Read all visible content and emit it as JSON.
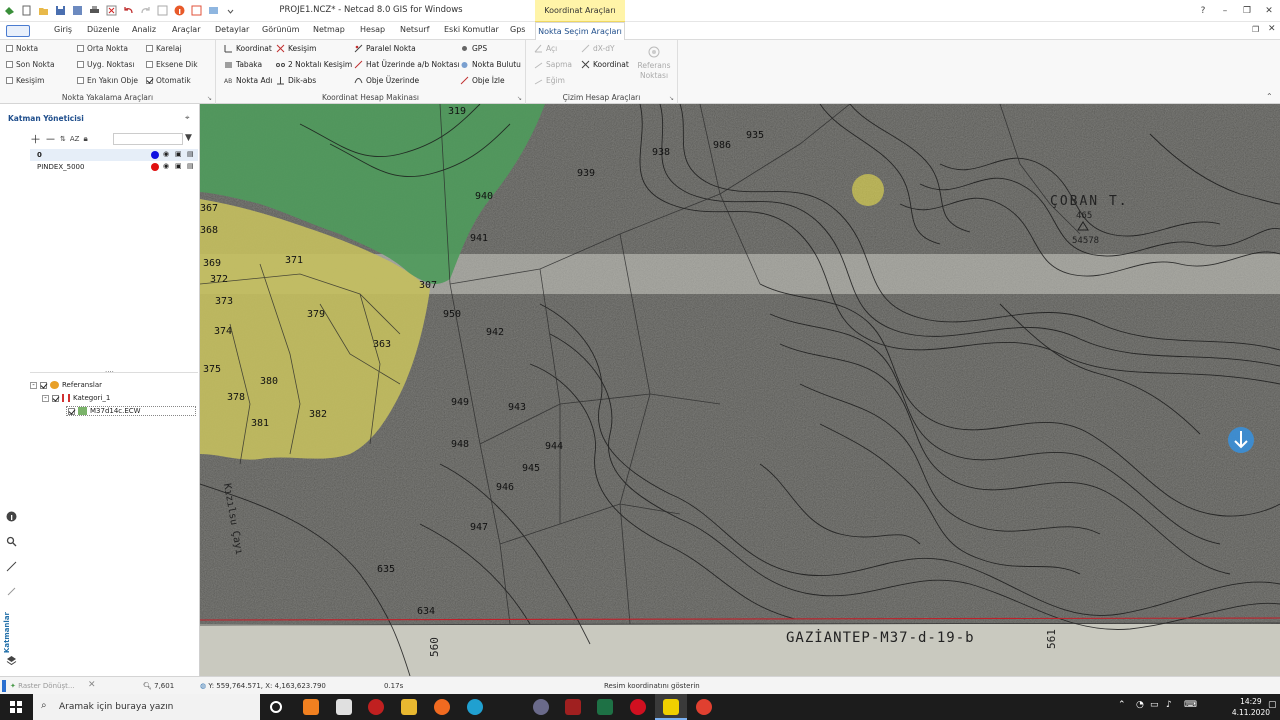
{
  "window": {
    "title": "PROJE1.NCZ* - Netcad 8.0 GIS for Windows",
    "context_tab": "Koordinat Araçları",
    "controls": [
      "?",
      "–",
      "❐",
      "✕"
    ]
  },
  "tabs": [
    "Giriş",
    "Düzenle",
    "Analiz",
    "Araçlar",
    "Detaylar",
    "Görünüm",
    "Netmap",
    "Hesap",
    "Netsurf",
    "Eski Komutlar",
    "Gps"
  ],
  "active_tab": "Nokta Seçim Araçları",
  "ribbon": {
    "snap_group": {
      "caption": "Nokta Yakalama Araçları",
      "items": [
        {
          "label": "Nokta",
          "checked": false
        },
        {
          "label": "Orta Nokta",
          "checked": false
        },
        {
          "label": "Karelaj",
          "checked": false
        },
        {
          "label": "Son Nokta",
          "checked": false
        },
        {
          "label": "Uyg. Noktası",
          "checked": false
        },
        {
          "label": "Eksene Dik",
          "checked": false
        },
        {
          "label": "Kesişim",
          "checked": false
        },
        {
          "label": "En Yakın Obje",
          "checked": false
        },
        {
          "label": "Otomatik",
          "checked": true
        }
      ]
    },
    "calc_group": {
      "caption": "Koordinat Hesap Makinası",
      "items": [
        "Koordinat",
        "Kesişim",
        "Paralel Nokta",
        "GPS",
        "Tabaka",
        "2 Noktalı Kesişim",
        "Hat Üzerinde a/b Noktası",
        "Nokta Bulutu",
        "Nokta Adı",
        "Dik-abs",
        "Obje Üzerinde",
        "Obje İzle"
      ]
    },
    "draw_group": {
      "caption": "Çizim Hesap Araçları",
      "items": [
        "Açı",
        "dX-dY",
        "Sapma",
        "Koordinat",
        "Eğim"
      ]
    },
    "ref_point": {
      "line1": "Referans",
      "line2": "Noktası"
    }
  },
  "layer_manager": {
    "title": "Katman Yöneticisi",
    "layers": [
      {
        "name": "0",
        "color": "#1010e0"
      },
      {
        "name": "PINDEX_5000",
        "color": "#e01010"
      }
    ],
    "dots": "....",
    "tree": {
      "root": "Referanslar",
      "category": "Kategori_1",
      "file": "M37d14c.ECW"
    },
    "side_label": "Katmanlar"
  },
  "map": {
    "parcels": [
      "319",
      "938",
      "986",
      "935",
      "939",
      "940",
      "941",
      "367",
      "368",
      "369",
      "371",
      "372",
      "373",
      "374",
      "379",
      "363",
      "307",
      "950",
      "942",
      "375",
      "380",
      "378",
      "382",
      "381",
      "949",
      "943",
      "948",
      "944",
      "945",
      "946",
      "947",
      "635",
      "634"
    ],
    "sheet_label": "GAZİANTEP-M37-d-19-b",
    "grid_left": "560",
    "grid_right": "561",
    "peak_name": "ÇOBAN T.",
    "peak_num": "465",
    "peak_elev": "54578",
    "stream_label": "Kızılsu Çayı"
  },
  "status": {
    "task": "Raster Dönüşt...",
    "zoom": "7,601",
    "coords": "Y: 559,764.571, X: 4,163,623.790",
    "time_val": "0.17s",
    "message": "Resim koordinatını gösterin"
  },
  "taskbar": {
    "search": "Aramak için buraya yazın",
    "time": "14:29",
    "date": "4.11.2020"
  },
  "colors": {
    "context_tab": "#fff4a8",
    "forest_green": "#4f9a5c",
    "parcel_yellow": "#c7c064",
    "map_paper": "#cfcfc6"
  }
}
